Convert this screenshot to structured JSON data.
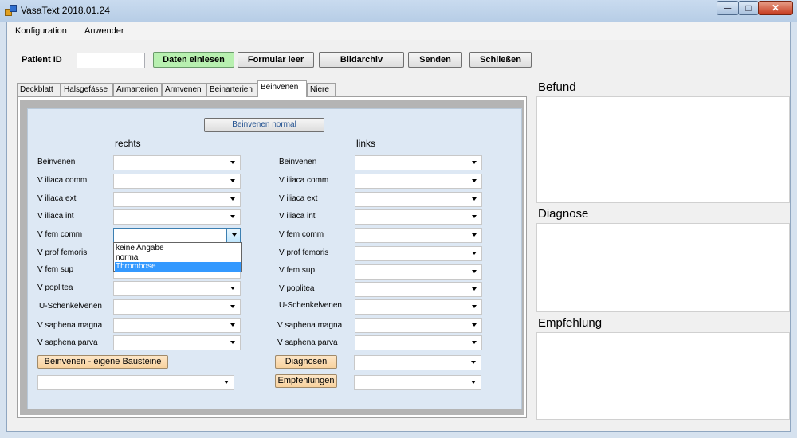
{
  "window": {
    "title": "VasaText  2018.01.24"
  },
  "titlebar": {
    "minimize": "─",
    "maximize": "□",
    "close": "✕"
  },
  "menu": [
    {
      "label": "Konfiguration"
    },
    {
      "label": "Anwender"
    }
  ],
  "toolbar": {
    "patient_id_label": "Patient ID",
    "patient_id_value": "",
    "buttons": {
      "daten_einlesen": "Daten einlesen",
      "formular_leer": "Formular leer",
      "bildarchiv": "Bildarchiv",
      "senden": "Senden",
      "schliessen": "Schließen"
    }
  },
  "tabs": [
    {
      "label": "Deckblatt"
    },
    {
      "label": "Halsgefässe"
    },
    {
      "label": "Armarterien"
    },
    {
      "label": "Armvenen"
    },
    {
      "label": "Beinarterien"
    },
    {
      "label": "Beinvenen",
      "active": true
    },
    {
      "label": "Niere"
    }
  ],
  "beinvenen": {
    "normal_button": "Beinvenen normal",
    "rechts_heading": "rechts",
    "links_heading": "links",
    "rechts_rows": [
      "Beinvenen",
      "V iliaca comm",
      "V iliaca ext",
      "V iliaca int",
      "V fem comm",
      "V prof femoris",
      "V fem sup",
      "V poplitea",
      "U-Schenkelvenen",
      "V saphena magna",
      "V saphena parva"
    ],
    "links_rows": [
      "Beinvenen",
      "V iliaca comm",
      "V iliaca ext",
      "V iliaca int",
      "V fem comm",
      "V prof femoris",
      "V fem sup",
      "V poplitea",
      "U-Schenkelvenen",
      "V saphena magna",
      "V saphena parva"
    ],
    "dropdown_options": [
      "keine Angabe",
      "normal",
      "Thrombose"
    ],
    "dropdown_selected": "Thrombose",
    "eigene_bausteine_button": "Beinvenen - eigene Bausteine",
    "diagnosen_button": "Diagnosen",
    "empfehlungen_button": "Empfehlungen"
  },
  "right_panel": {
    "befund_title": "Befund",
    "diagnose_title": "Diagnose",
    "empfehlung_title": "Empfehlung"
  },
  "colors": {
    "accent_green": "#b8f0b0",
    "accent_peach": "#f8d29e",
    "selection_blue": "#3399ff",
    "panel_blue": "#dde8f4"
  }
}
